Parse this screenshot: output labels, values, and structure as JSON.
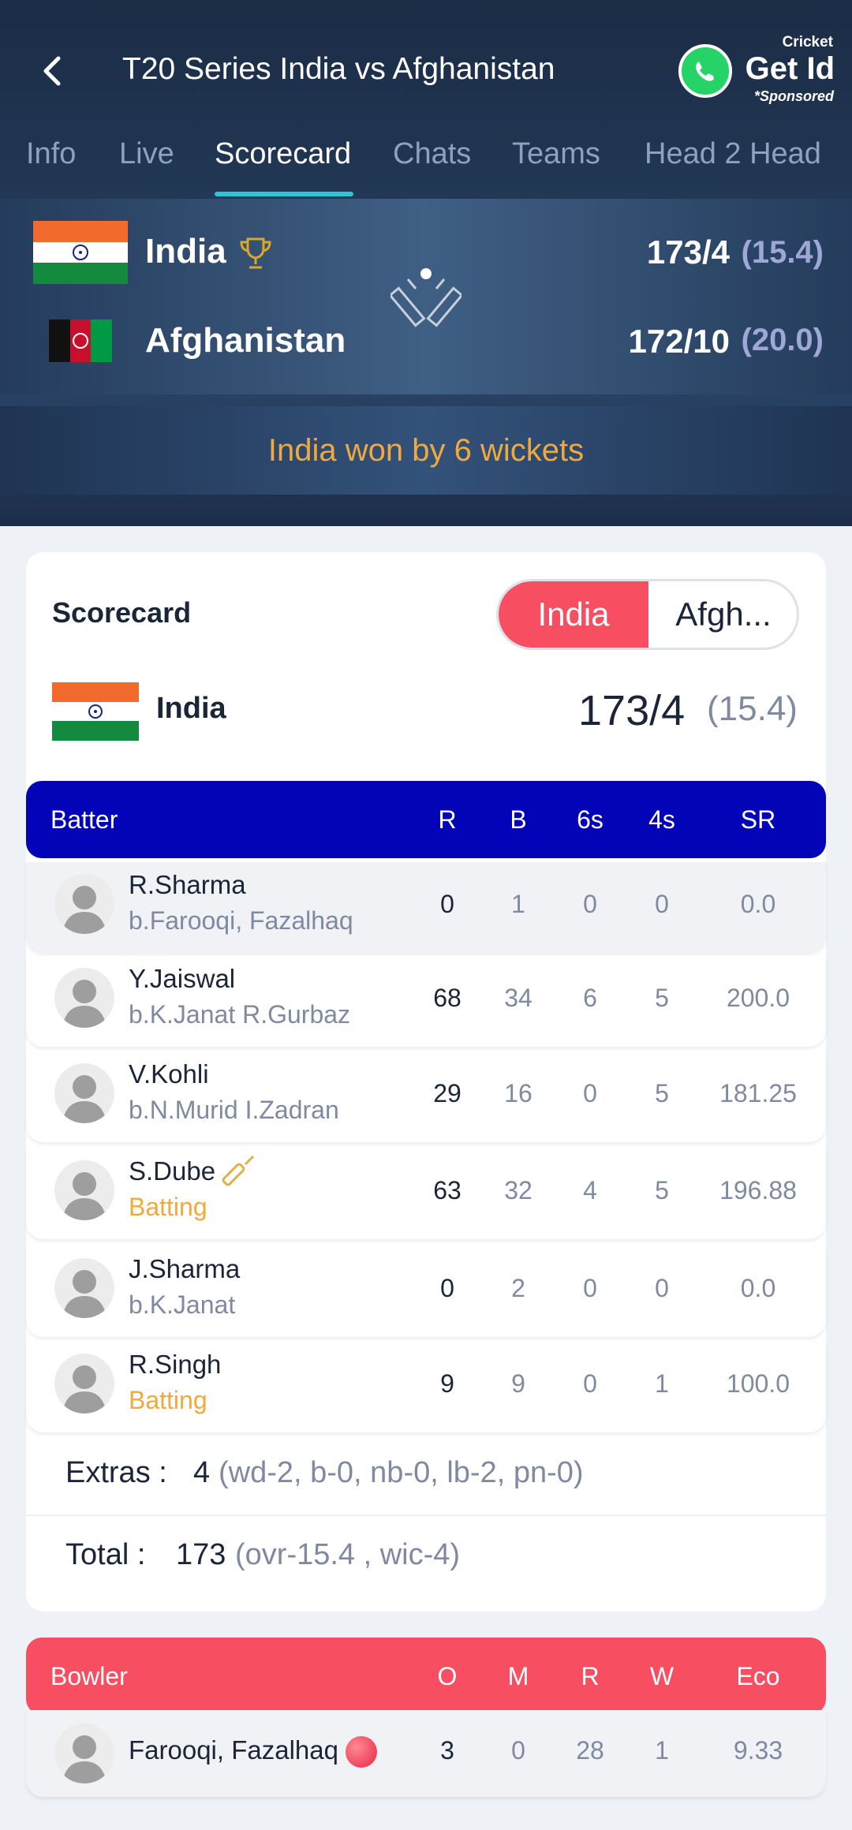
{
  "header": {
    "title": "T20 Series India vs Afghanistan",
    "promo": {
      "small": "Cricket",
      "big": "Get Id",
      "sponsored": "*Sponsored"
    }
  },
  "tabs": [
    "Info",
    "Live",
    "Scorecard",
    "Chats",
    "Teams",
    "Head 2 Head"
  ],
  "active_tab": "Scorecard",
  "match": {
    "team1": {
      "name": "India",
      "score": "173/4",
      "overs": "(15.4)"
    },
    "team2": {
      "name": "Afghanistan",
      "score": "172/10",
      "overs": "(20.0)"
    },
    "result": "India won by 6 wickets"
  },
  "scorecard": {
    "label": "Scorecard",
    "toggle": {
      "selected": "India",
      "other": "Afgh..."
    },
    "team": {
      "name": "India",
      "score": "173/4",
      "overs": "(15.4)"
    },
    "batting_headers": [
      "Batter",
      "R",
      "B",
      "6s",
      "4s",
      "SR"
    ],
    "batters": [
      {
        "name": "R.Sharma",
        "dismissal": "b.Farooqi, Fazalhaq",
        "r": "0",
        "b": "1",
        "sixes": "0",
        "fours": "0",
        "sr": "0.0"
      },
      {
        "name": "Y.Jaiswal",
        "dismissal": "b.K.Janat R.Gurbaz",
        "r": "68",
        "b": "34",
        "sixes": "6",
        "fours": "5",
        "sr": "200.0"
      },
      {
        "name": "V.Kohli",
        "dismissal": "b.N.Murid I.Zadran",
        "r": "29",
        "b": "16",
        "sixes": "0",
        "fours": "5",
        "sr": "181.25"
      },
      {
        "name": "S.Dube",
        "dismissal": "Batting",
        "r": "63",
        "b": "32",
        "sixes": "4",
        "fours": "5",
        "sr": "196.88"
      },
      {
        "name": "J.Sharma",
        "dismissal": "b.K.Janat",
        "r": "0",
        "b": "2",
        "sixes": "0",
        "fours": "0",
        "sr": "0.0"
      },
      {
        "name": "R.Singh",
        "dismissal": "Batting",
        "r": "9",
        "b": "9",
        "sixes": "0",
        "fours": "1",
        "sr": "100.0"
      }
    ],
    "extras": {
      "label": "Extras :",
      "value": "4",
      "detail": "(wd-2, b-0, nb-0, lb-2, pn-0)"
    },
    "total": {
      "label": "Total :",
      "value": "173",
      "detail": "(ovr-15.4 , wic-4)"
    },
    "bowling_headers": [
      "Bowler",
      "O",
      "M",
      "R",
      "W",
      "Eco"
    ],
    "bowlers": [
      {
        "name": "Farooqi, Fazalhaq",
        "o": "3",
        "m": "0",
        "r": "28",
        "w": "1",
        "eco": "9.33"
      }
    ]
  },
  "colors": {
    "accent": "#f74e62",
    "batting_header": "#0303b8",
    "result": "#f0a93d",
    "tab_indicator": "#2ec5d8"
  }
}
